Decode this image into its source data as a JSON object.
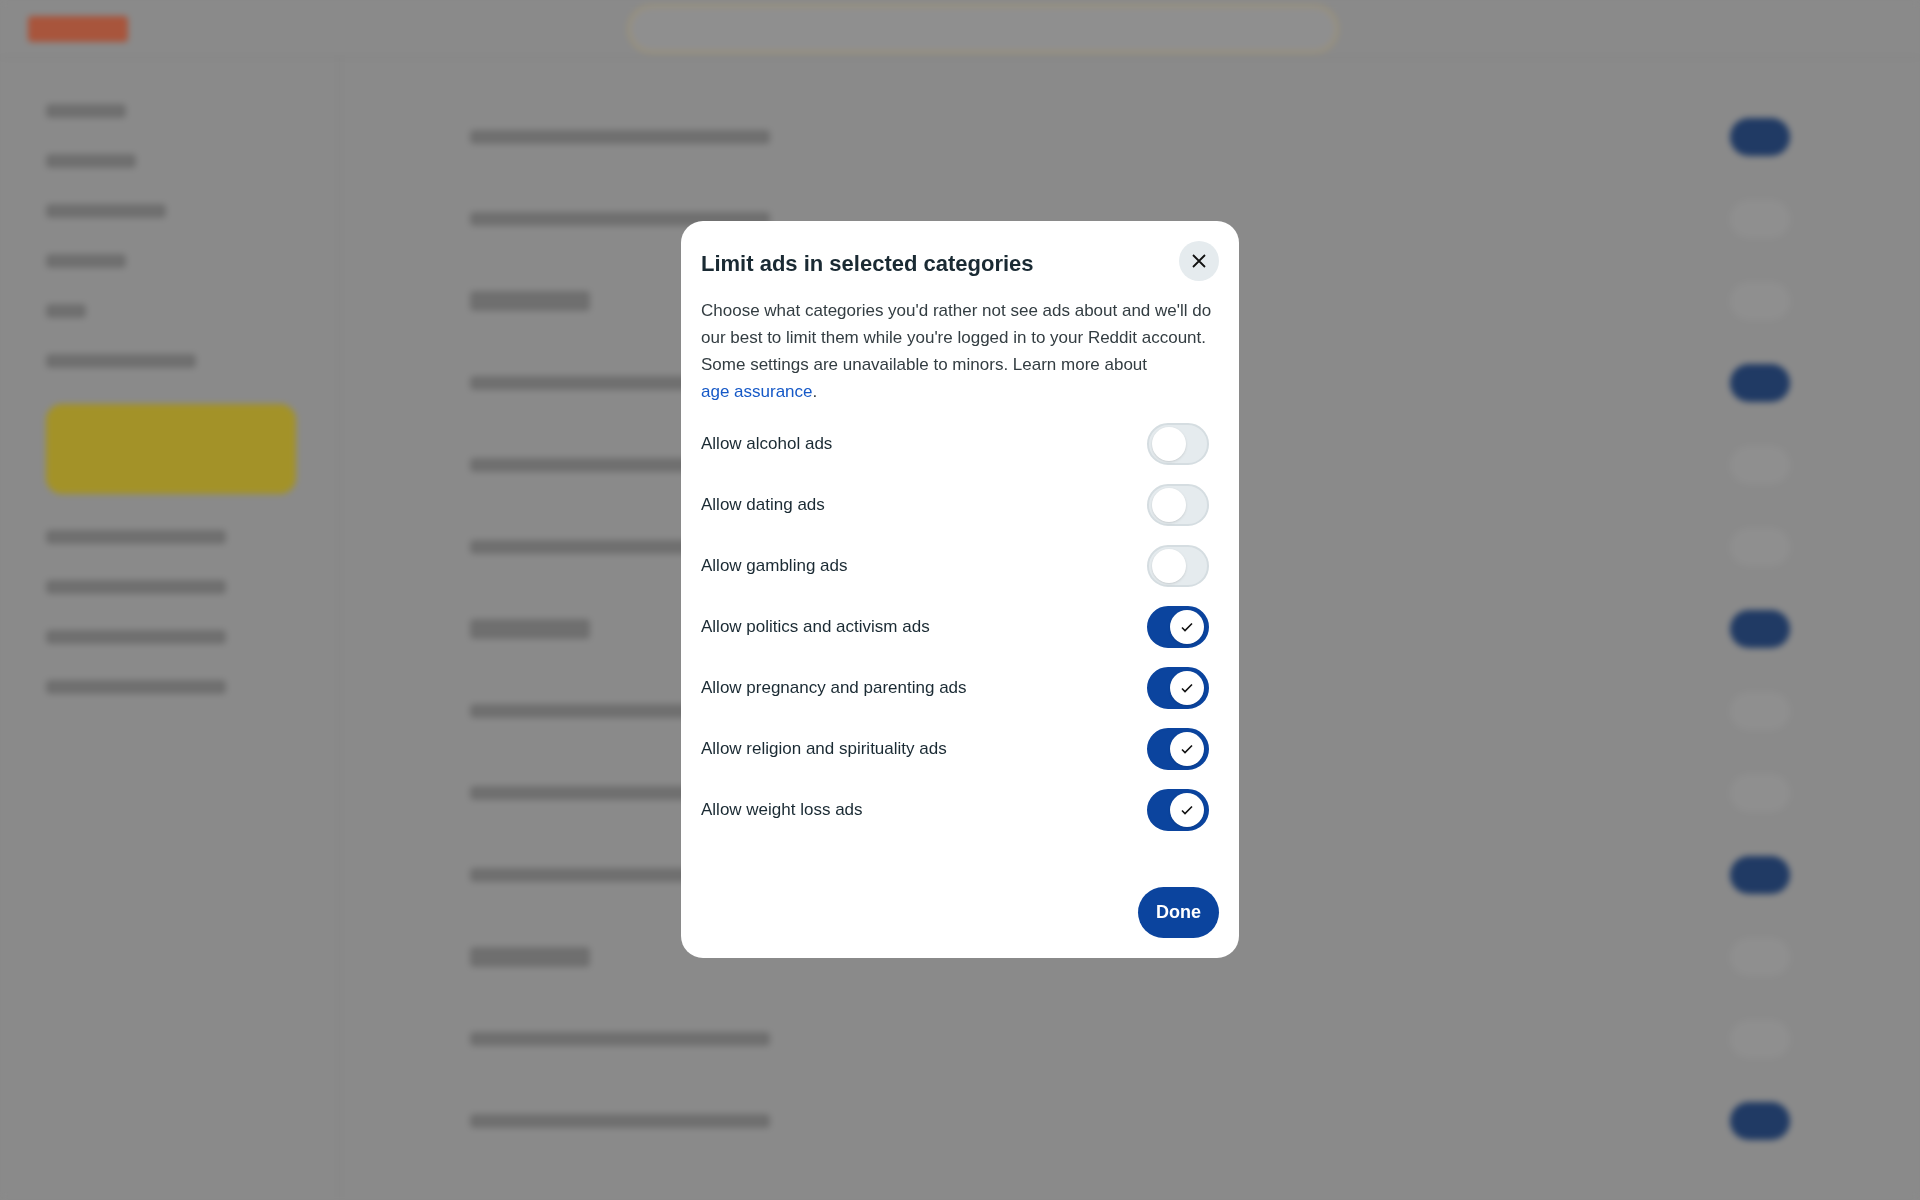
{
  "dialog": {
    "title": "Limit ads in selected categories",
    "description_parts": [
      "Choose what categories you'd rather not see ads about and we'll do our best to limit them while you're logged in to your Reddit account. Some settings are unavailable to minors. Learn more about ",
      "age assurance",
      "."
    ],
    "options": [
      {
        "label": "Allow alcohol ads",
        "on": false
      },
      {
        "label": "Allow dating ads",
        "on": false
      },
      {
        "label": "Allow gambling ads",
        "on": false
      },
      {
        "label": "Allow politics and activism ads",
        "on": true
      },
      {
        "label": "Allow pregnancy and parenting ads",
        "on": true
      },
      {
        "label": "Allow religion and spirituality ads",
        "on": true
      },
      {
        "label": "Allow weight loss ads",
        "on": true
      }
    ],
    "done_button": "Done"
  }
}
